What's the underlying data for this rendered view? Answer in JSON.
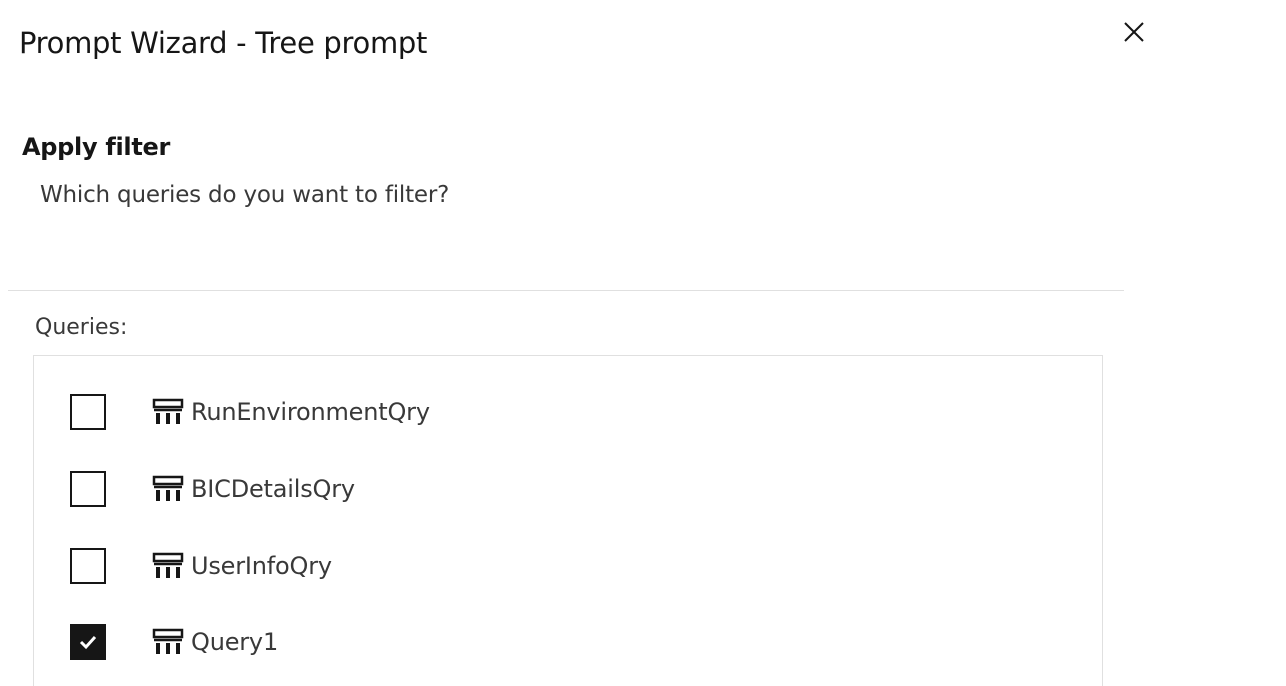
{
  "dialog": {
    "title": "Prompt Wizard - Tree prompt",
    "close_icon": "close-icon"
  },
  "step": {
    "heading": "Apply filter",
    "description": "Which queries do you want to filter?"
  },
  "queries": {
    "label": "Queries:",
    "items": [
      {
        "label": "RunEnvironmentQry",
        "checked": false,
        "icon": "query-table-icon"
      },
      {
        "label": "BICDetailsQry",
        "checked": false,
        "icon": "query-table-icon"
      },
      {
        "label": "UserInfoQry",
        "checked": false,
        "icon": "query-table-icon"
      },
      {
        "label": "Query1",
        "checked": true,
        "icon": "query-table-icon"
      }
    ]
  },
  "colors": {
    "text_primary": "#161616",
    "text_secondary": "#393939",
    "border": "#e0e0e0",
    "checkbox_checked": "#161616"
  }
}
